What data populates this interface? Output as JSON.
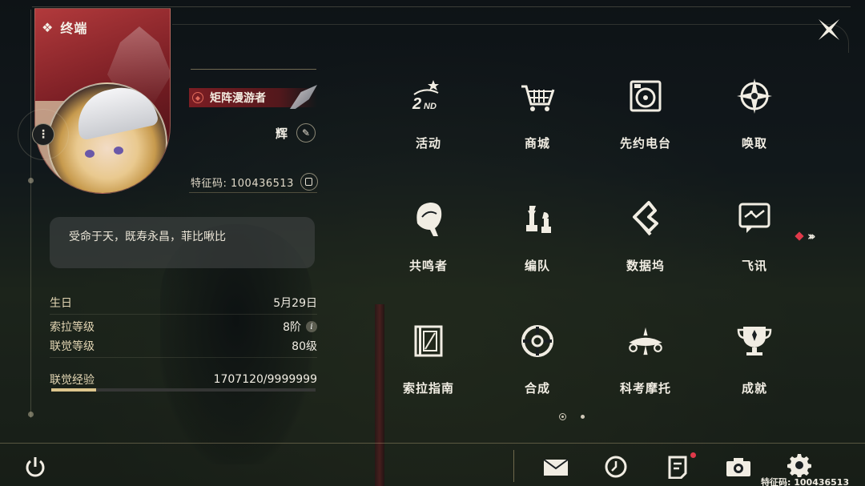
{
  "header": {
    "title": "终端"
  },
  "profile": {
    "title_badge": "矩阵漫游者",
    "name": "辉",
    "uid": "特征码: 100436513",
    "signature": "受命于天，既寿永昌，菲比啾比"
  },
  "stats": {
    "birthday_label": "生日",
    "birthday_value": "5月29日",
    "sola_level_label": "索拉等级",
    "sola_level_value": "8阶",
    "union_level_label": "联觉等级",
    "union_level_value": "80级",
    "union_exp_label": "联觉经验",
    "union_exp_value": "1707120/9999999",
    "union_exp_fraction": 0.1707
  },
  "menu": [
    {
      "id": "activity",
      "label": "活动",
      "icon": "2nd-anniversary-icon"
    },
    {
      "id": "shop",
      "label": "商城",
      "icon": "shopping-cart-icon"
    },
    {
      "id": "radio",
      "label": "先约电台",
      "icon": "radio-record-icon"
    },
    {
      "id": "convene",
      "label": "唤取",
      "icon": "compass-star-icon"
    },
    {
      "id": "resonators",
      "label": "共鸣者",
      "icon": "character-head-icon"
    },
    {
      "id": "team",
      "label": "编队",
      "icon": "chess-pieces-icon"
    },
    {
      "id": "databank",
      "label": "数据坞",
      "icon": "databank-icon"
    },
    {
      "id": "messenger",
      "label": "飞讯",
      "icon": "chat-bubble-icon"
    },
    {
      "id": "guide",
      "label": "索拉指南",
      "icon": "guide-book-icon"
    },
    {
      "id": "synthesis",
      "label": "合成",
      "icon": "synthesis-icon"
    },
    {
      "id": "motorcycle",
      "label": "科考摩托",
      "icon": "motorcycle-icon"
    },
    {
      "id": "achievements",
      "label": "成就",
      "icon": "trophy-icon"
    }
  ],
  "pagination": {
    "current": 1,
    "total": 2
  },
  "footer": {
    "uid": "特征码: 100436513"
  },
  "colors": {
    "accent_gold": "#dcc58c",
    "accent_red": "#e0394a",
    "badge_red": "#8a1e24"
  }
}
